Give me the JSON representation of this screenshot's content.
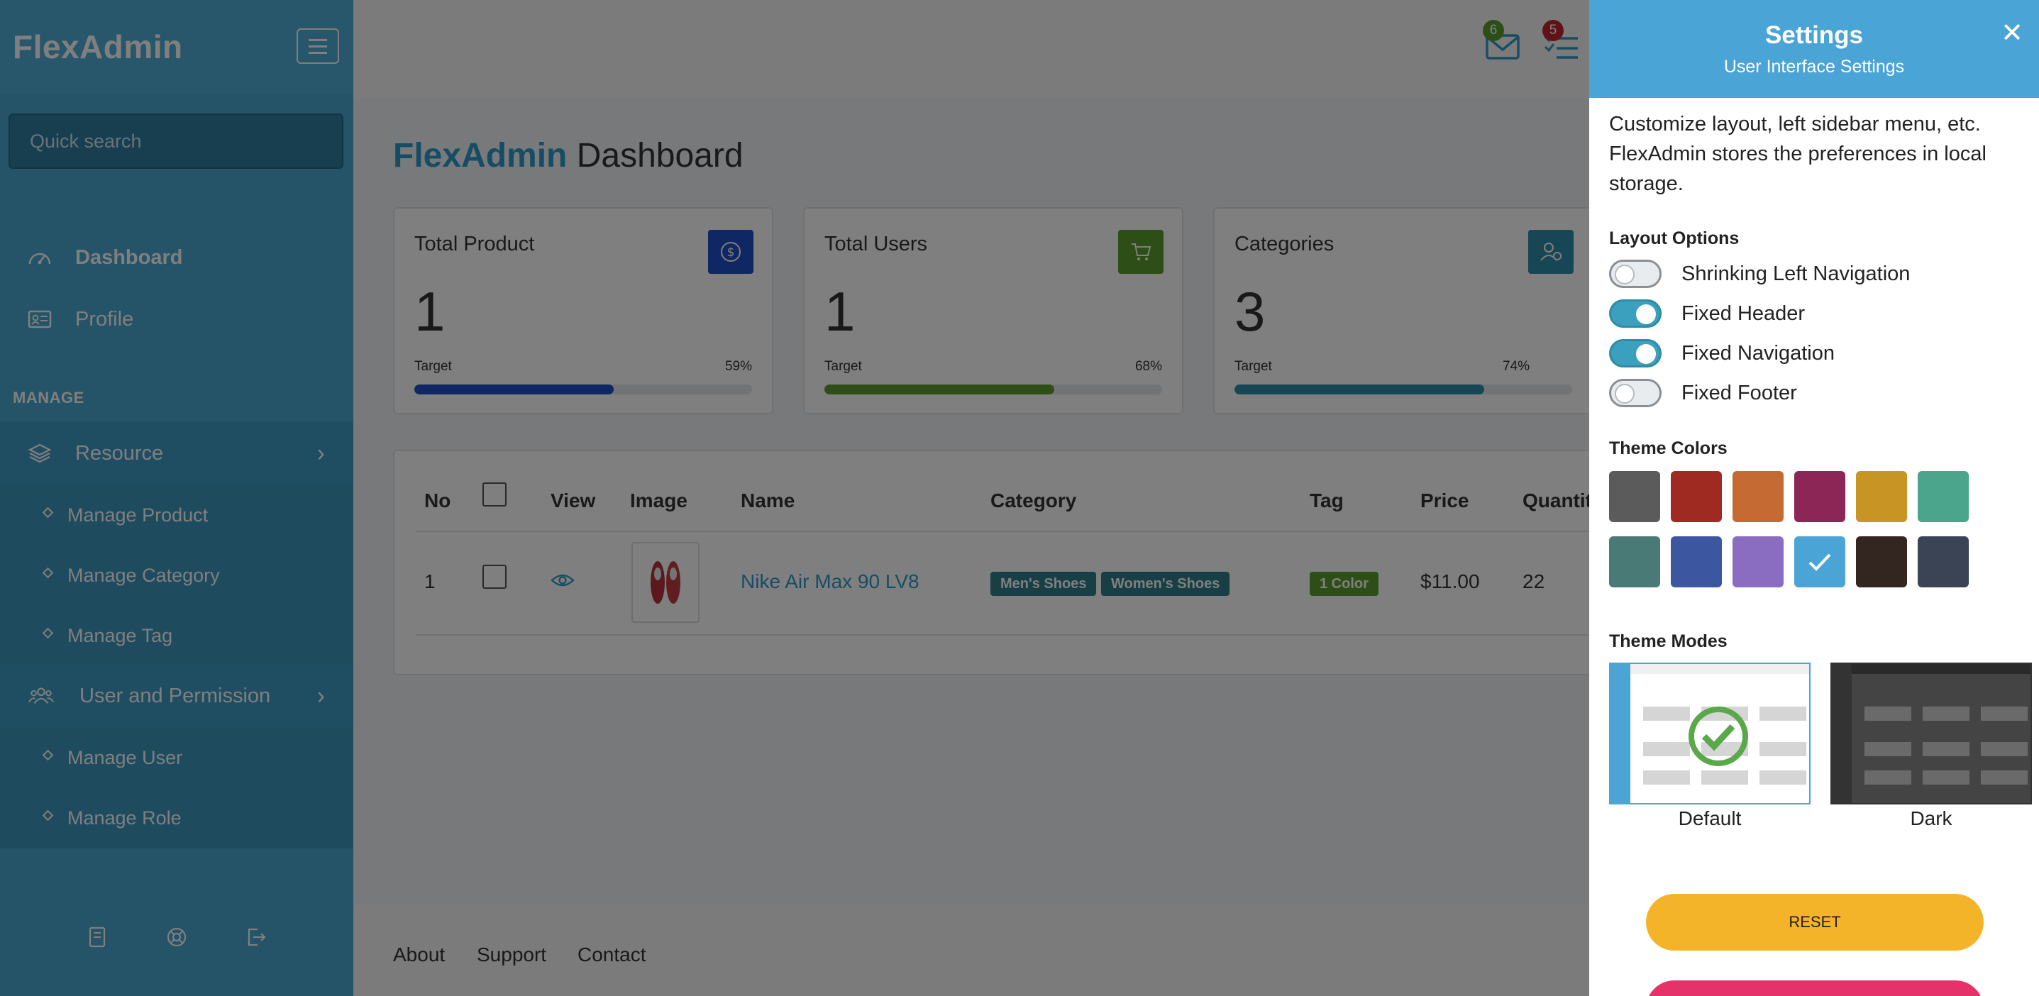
{
  "sidebar": {
    "brand": "FlexAdmin",
    "search_placeholder": "Quick search",
    "nav": [
      {
        "label": "Dashboard"
      },
      {
        "label": "Profile"
      }
    ],
    "section_manage": "MANAGE",
    "groups": [
      {
        "label": "Resource",
        "items": [
          "Manage Product",
          "Manage Category",
          "Manage Tag"
        ]
      },
      {
        "label": "User and Permission",
        "items": [
          "Manage User",
          "Manage Role"
        ]
      }
    ]
  },
  "header": {
    "mail_badge": "6",
    "tasks_badge": "5"
  },
  "main": {
    "title_brand": "FlexAdmin",
    "title_rest": "Dashboard",
    "cards": [
      {
        "title": "Total Product",
        "value": "1",
        "target_label": "Target",
        "percent": "59%",
        "progress": 59,
        "icon": "dollar-icon",
        "color": "#1f4fc4",
        "bar_color": "#1f4fc4"
      },
      {
        "title": "Total Users",
        "value": "1",
        "target_label": "Target",
        "percent": "68%",
        "progress": 68,
        "icon": "cart-icon",
        "color": "#5a9e2e",
        "bar_color": "#5a9e2e"
      },
      {
        "title": "Categories",
        "value": "3",
        "target_label": "Target",
        "percent": "74%",
        "progress": 74,
        "icon": "user-icon",
        "color": "#2e8fa8",
        "bar_color": "#2e8fa8"
      }
    ],
    "table": {
      "headers": [
        "No",
        "View",
        "Image",
        "Name",
        "Category",
        "Tag",
        "Price",
        "Quantit"
      ],
      "rows": [
        {
          "no": "1",
          "name": "Nike Air Max 90 LV8",
          "categories": [
            "Men's Shoes",
            "Women's Shoes"
          ],
          "tag": "1 Color",
          "price": "$11.00",
          "quantity": "22"
        }
      ]
    }
  },
  "footer": {
    "links": [
      "About",
      "Support",
      "Contact"
    ]
  },
  "settings": {
    "title": "Settings",
    "subtitle": "User Interface Settings",
    "description": "Customize layout, left sidebar menu, etc. FlexAdmin stores the preferences in local storage.",
    "layout_heading": "Layout Options",
    "toggles": [
      {
        "label": "Shrinking Left Navigation",
        "on": false
      },
      {
        "label": "Fixed Header",
        "on": true
      },
      {
        "label": "Fixed Navigation",
        "on": true
      },
      {
        "label": "Fixed Footer",
        "on": false
      }
    ],
    "colors_heading": "Theme Colors",
    "colors": [
      "#5b5b5b",
      "#9e2a22",
      "#c66a33",
      "#8c2656",
      "#c89424",
      "#4aa58c",
      "#4a7a76",
      "#3d56a0",
      "#8a6cc0",
      "#4ba4d6",
      "#332520",
      "#3b4455"
    ],
    "selected_color": 9,
    "modes_heading": "Theme Modes",
    "modes": [
      "Default",
      "Dark"
    ],
    "reset_label": "RESET"
  }
}
